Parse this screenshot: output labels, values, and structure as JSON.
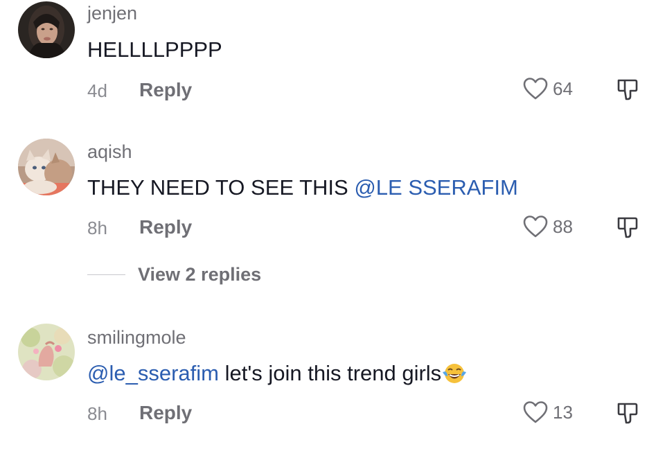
{
  "comments": [
    {
      "username": "jenjen",
      "text": "HELLLLPPPP",
      "time": "4d",
      "reply_label": "Reply",
      "likes": "64"
    },
    {
      "username": "aqish",
      "text": "THEY NEED TO SEE THIS ",
      "mention": "@LE SSERAFIM",
      "time": "8h",
      "reply_label": "Reply",
      "likes": "88",
      "view_replies": "View 2 replies"
    },
    {
      "username": "smilingmole",
      "mention": "@le_sserafim",
      "text": " let's join this trend girls",
      "emoji": "face-with-tears-of-joy",
      "time": "8h",
      "reply_label": "Reply",
      "likes": "13"
    }
  ],
  "colors": {
    "mention": "#2b5db0",
    "username": "#6f6f75",
    "text": "#161823",
    "meta": "#8a8b91"
  }
}
